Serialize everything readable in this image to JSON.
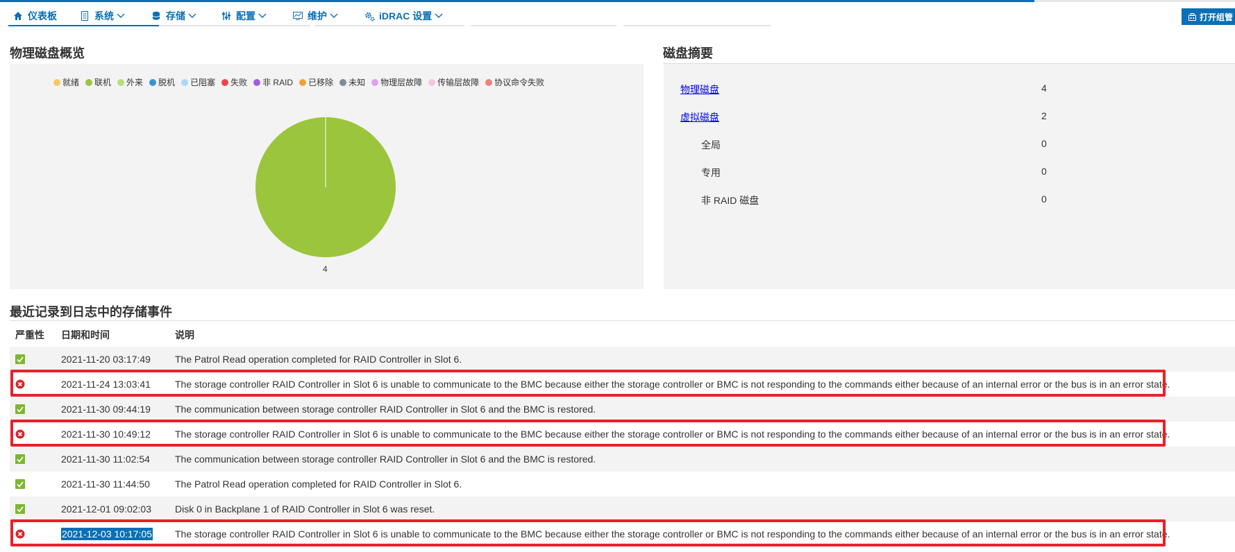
{
  "colors": {
    "accent": "#0b6fb5",
    "highlight_box": "#e8202a",
    "pie_online": "#9bc53d"
  },
  "nav": {
    "items": [
      {
        "label": "仪表板",
        "icon": "home-icon"
      },
      {
        "label": "系统",
        "icon": "server-icon"
      },
      {
        "label": "存储",
        "icon": "database-icon"
      },
      {
        "label": "配置",
        "icon": "sliders-icon"
      },
      {
        "label": "维护",
        "icon": "monitor-icon"
      },
      {
        "label": "iDRAC 设置",
        "icon": "gears-icon"
      }
    ],
    "group_button": "打开组管"
  },
  "overview": {
    "title": "物理磁盘概览",
    "legend": [
      {
        "label": "就绪",
        "color": "#f6c85f"
      },
      {
        "label": "联机",
        "color": "#9bc53d"
      },
      {
        "label": "外来",
        "color": "#b7de7a"
      },
      {
        "label": "脱机",
        "color": "#3a93d8"
      },
      {
        "label": "已阻塞",
        "color": "#a9d8f5"
      },
      {
        "label": "失败",
        "color": "#e84848"
      },
      {
        "label": "非 RAID",
        "color": "#a05ee0"
      },
      {
        "label": "已移除",
        "color": "#f5a03a"
      },
      {
        "label": "未知",
        "color": "#7e8a99"
      },
      {
        "label": "物理层故障",
        "color": "#e0a0f0"
      },
      {
        "label": "传输层故障",
        "color": "#f7c4e0"
      },
      {
        "label": "协议命令失败",
        "color": "#f08080"
      }
    ],
    "pie_value_label": "4"
  },
  "chart_data": {
    "type": "pie",
    "categories": [
      "联机"
    ],
    "values": [
      4
    ]
  },
  "summary": {
    "title": "磁盘摘要",
    "rows": [
      {
        "label": "物理磁盘",
        "value": "4",
        "link": true
      },
      {
        "label": "虚拟磁盘",
        "value": "2",
        "link": true
      },
      {
        "label": "全局",
        "value": "0",
        "link": false
      },
      {
        "label": "专用",
        "value": "0",
        "link": false
      },
      {
        "label": "非 RAID 磁盘",
        "value": "0",
        "link": false
      }
    ]
  },
  "events": {
    "title": "最近记录到日志中的存储事件",
    "headers": {
      "severity": "严重性",
      "datetime": "日期和时间",
      "description": "说明"
    },
    "rows": [
      {
        "severity": "ok",
        "datetime": "2021-11-20 03:17:49",
        "description": "The Patrol Read operation completed for RAID Controller in Slot 6."
      },
      {
        "severity": "error",
        "datetime": "2021-11-24 13:03:41",
        "description": "The storage controller RAID Controller in Slot 6 is unable to communicate to the BMC because either the storage controller or BMC is not responding to the commands either because of an internal error or the bus is in an error state."
      },
      {
        "severity": "ok",
        "datetime": "2021-11-30 09:44:19",
        "description": "The communication between storage controller RAID Controller in Slot 6 and the BMC is restored."
      },
      {
        "severity": "error",
        "datetime": "2021-11-30 10:49:12",
        "description": "The storage controller RAID Controller in Slot 6 is unable to communicate to the BMC because either the storage controller or BMC is not responding to the commands either because of an internal error or the bus is in an error state."
      },
      {
        "severity": "ok",
        "datetime": "2021-11-30 11:02:54",
        "description": "The communication between storage controller RAID Controller in Slot 6 and the BMC is restored."
      },
      {
        "severity": "ok",
        "datetime": "2021-11-30 11:44:50",
        "description": "The Patrol Read operation completed for RAID Controller in Slot 6."
      },
      {
        "severity": "ok",
        "datetime": "2021-12-01 09:02:03",
        "description": "Disk 0 in Backplane 1 of RAID Controller in Slot 6 was reset."
      },
      {
        "severity": "error",
        "datetime": "2021-12-03 10:17:05",
        "description": "The storage controller RAID Controller in Slot 6 is unable to communicate to the BMC because either the storage controller or BMC is not responding to the commands either because of an internal error or the bus is in an error state."
      }
    ]
  }
}
